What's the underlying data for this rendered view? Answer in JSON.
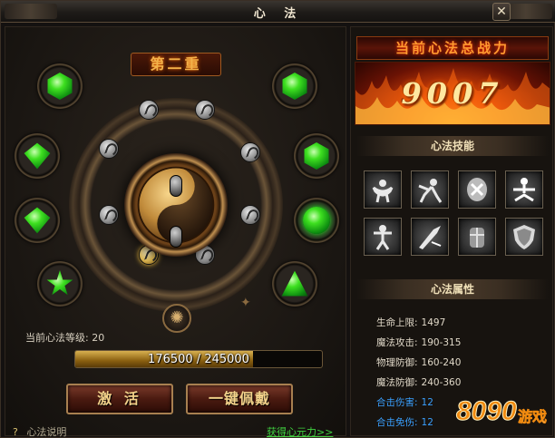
{
  "window": {
    "title": "心 法",
    "close_label": "✕"
  },
  "board": {
    "tier_label": "第二重",
    "gems": [
      {
        "name": "gem-top-left",
        "shape": "hex"
      },
      {
        "name": "gem-mid-left-1",
        "shape": "diamond"
      },
      {
        "name": "gem-mid-left-2",
        "shape": "diamond"
      },
      {
        "name": "gem-bottom-left",
        "shape": "star"
      },
      {
        "name": "gem-top-right",
        "shape": "hex"
      },
      {
        "name": "gem-mid-right-1",
        "shape": "hex"
      },
      {
        "name": "gem-mid-right-2",
        "shape": "ring"
      },
      {
        "name": "gem-bottom-right",
        "shape": "tri"
      }
    ],
    "level_label": "当前心法等级:",
    "level_value": "20",
    "xp_current": 176500,
    "xp_max": 245000,
    "xp_text": "176500 / 245000",
    "activate_label": "激 活",
    "equip_label": "一键佩戴",
    "help_icon": "?",
    "help_label": "心法说明",
    "gain_label": "获得心元力>>"
  },
  "power": {
    "title": "当前心法总战力",
    "value": "9007"
  },
  "skills": {
    "title": "心法技能",
    "icons": [
      "strength-pose-icon",
      "martial-arts-icon",
      "shield-fist-icon",
      "meditation-icon",
      "warrior-stance-icon",
      "charge-attack-icon",
      "armor-guard-icon",
      "defense-shield-icon"
    ]
  },
  "attributes": {
    "title": "心法属性",
    "rows": [
      {
        "label": "生命上限:",
        "value": "1497",
        "color": "#e0d8c8"
      },
      {
        "label": "魔法攻击:",
        "value": "190-315",
        "color": "#e0d8c8"
      },
      {
        "label": "物理防御:",
        "value": "160-240",
        "color": "#e0d8c8"
      },
      {
        "label": "魔法防御:",
        "value": "240-360",
        "color": "#e0d8c8"
      },
      {
        "label": "合击伤害:",
        "value": "12",
        "color": "#3aa0ff"
      },
      {
        "label": "合击免伤:",
        "value": "12",
        "color": "#3aa0ff"
      }
    ]
  },
  "watermark": {
    "text": "8090游戏"
  }
}
